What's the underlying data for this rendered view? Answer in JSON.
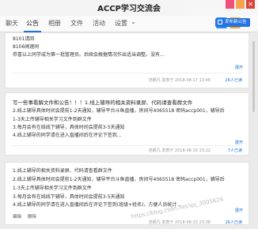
{
  "window": {
    "title": "ACCP学习交流会",
    "close_glyph": "✕"
  },
  "tabs": [
    {
      "label": "聊天"
    },
    {
      "label": "公告"
    },
    {
      "label": "相册"
    },
    {
      "label": "文件"
    },
    {
      "label": "活动"
    },
    {
      "label": "设置"
    }
  ],
  "settings_chevron": "⌄",
  "more_glyph": "⋮",
  "publish_button": {
    "label": "发布新公告"
  },
  "notices": [
    {
      "lines": [
        "8101请回",
        "8106阀速同",
        "恭喜以上同学成为第一批管理员。后续会根据情况作出适当调整。没有..."
      ],
      "expand": "展开",
      "meta": "范颖凡 发表于 2018-08-17 13:48",
      "reads": "26人已读"
    },
    {
      "lines": [
        "写一些事看解文件和公告！！！1.线上辅导的相关资料录屏、代码请查看群文件",
        "2.线上辅导具体时间会提前1-2天通知，辅导平台斗鱼直播，房间号4065518 密码accp001，辅导后",
        "1-3天上传辅导相关学习文件到群文件",
        "3.每月会有在线线下辅导，具体时间会提前3-5天通知",
        "4.线上辅导的同学请在进入直播间后在评论下签到..."
      ],
      "expand": "展开",
      "meta": "范颖凡 发表于 2018-08-15 23:22",
      "reads": "7人已读"
    },
    {
      "lines": [
        "1.线上辅导的相关资料录屏、代码请查看群文件",
        "2.线上辅导具体时间会提前1-2天通知，辅导平台斗鱼直播，房间号4065518 密码accp001，辅导后",
        "1-3天上传辅导相关学习文件到群文件",
        "3.每月会有在线线下辅导，具体时间会提前3-5天通知",
        "4.线上辅导的同学请在进入直播间后在评论下签到(班级+姓名)，方便人员统计..."
      ],
      "expand": "展开",
      "meta": "范颖凡 发表于 2018-08-15 23:08",
      "reads": "26人已读",
      "actions": [
        "编辑",
        "删除"
      ]
    }
  ],
  "watermark": "https://blog.csdn.net/qq_3005624"
}
